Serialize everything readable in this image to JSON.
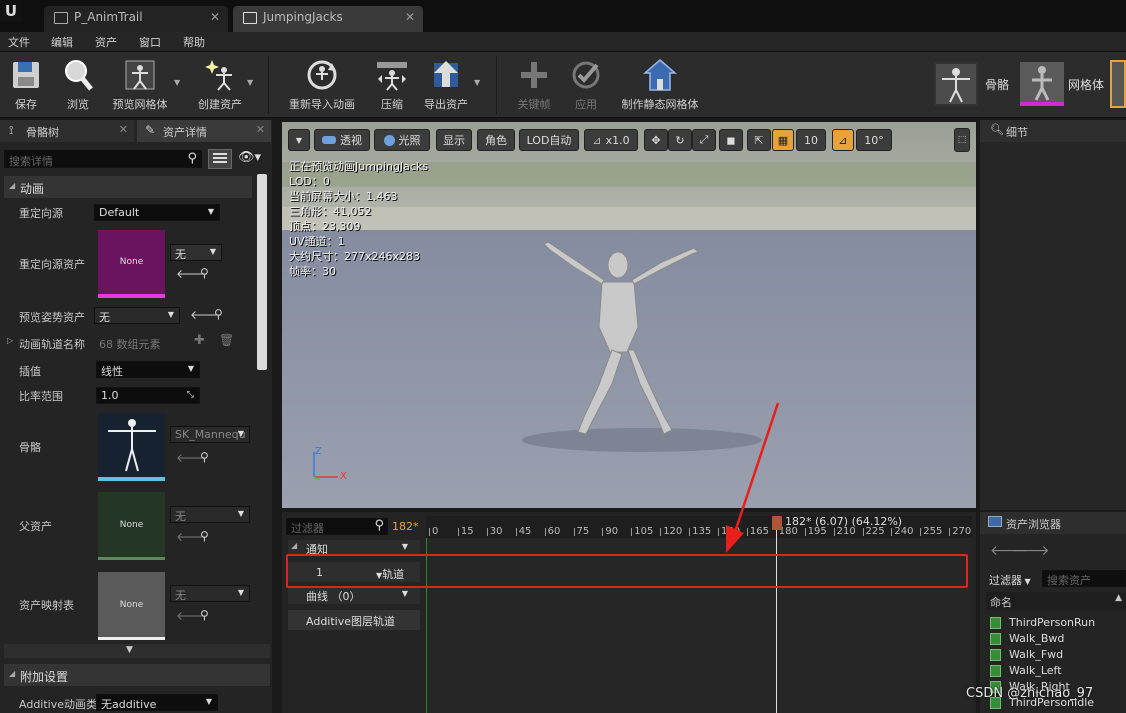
{
  "title_bar": {
    "logo": "U",
    "tabs": [
      {
        "label": "P_AnimTrail",
        "icon": "level-icon",
        "active": false
      },
      {
        "label": "JumpingJacks",
        "icon": "animation-sequence-icon",
        "active": true
      }
    ]
  },
  "menu": [
    "文件",
    "编辑",
    "资产",
    "窗口",
    "帮助"
  ],
  "toolbar": {
    "save": "保存",
    "browse": "浏览",
    "preview_mesh": "预览网格体",
    "create_asset": "创建资产",
    "reimport": "重新导入动画",
    "compress": "压缩",
    "export": "导出资产",
    "keyframe": "关键帧",
    "apply": "应用",
    "make_static_mesh": "制作静态网格体",
    "skeleton": "骨骼",
    "mesh": "网格体"
  },
  "left_panel": {
    "tabs": [
      "骨骼树",
      "资产详情"
    ],
    "search_placeholder": "搜索详情",
    "animation_category": "动画",
    "retarget_source_label": "重定向源",
    "retarget_source_value": "Default",
    "retarget_source_asset_label": "重定向源资产",
    "retarget_source_asset_thumb": "None",
    "retarget_source_asset_value": "无",
    "preview_pose_label": "预览姿势资产",
    "preview_pose_value": "无",
    "anim_track_names_label": "动画轨道名称",
    "anim_track_names_value": "68 数组元素",
    "interpolation_label": "插值",
    "interpolation_value": "线性",
    "rate_scale_label": "比率范围",
    "rate_scale_value": "1.0",
    "skeleton_label": "骨骼",
    "skeleton_value": "SK_Mannequ",
    "parent_asset_label": "父资产",
    "parent_asset_thumb": "None",
    "parent_asset_value": "无",
    "asset_mapping_label": "资产映射表",
    "asset_mapping_thumb": "None",
    "asset_mapping_value": "无",
    "additional_settings": "附加设置",
    "additive_type_label": "Additive动画类",
    "additive_type_value": "无additive"
  },
  "viewport": {
    "toolbar": {
      "perspective": "透视",
      "lit": "光照",
      "show": "显示",
      "character": "角色",
      "lod": "LOD自动",
      "speed": "x1.0",
      "grid_snap": "10",
      "rot_snap": "10°"
    },
    "info": [
      "正在预览动画JumpingJacks",
      "LOD：0",
      "当前屏幕大小：1.463",
      "三角形：41,052",
      "顶点：23,309",
      "UV通道：1",
      "大约尺寸：277x246x283",
      "帧率：30"
    ],
    "axis": {
      "z": "Z",
      "x": "X"
    }
  },
  "timeline": {
    "filter_placeholder": "过滤器",
    "frame_count": "182*",
    "playhead": "182* (6.07) (64.12%)",
    "ticks": [
      "0",
      "15",
      "30",
      "45",
      "60",
      "75",
      "90",
      "105",
      "120",
      "135",
      "150",
      "165",
      "180",
      "195",
      "210",
      "225",
      "240",
      "255",
      "270"
    ],
    "notify_label": "通知",
    "track_number": "1",
    "track_label": "轨道",
    "curves_label": "曲线 （0）",
    "additive_track_label": "Additive图层轨道"
  },
  "details_panel": {
    "title": "细节"
  },
  "asset_browser": {
    "title": "资产浏览器",
    "filter": "过滤器",
    "search_placeholder": "搜索资产",
    "column": "命名",
    "items": [
      "ThirdPersonRun",
      "Walk_Bwd",
      "Walk_Fwd",
      "Walk_Left",
      "Walk_Right",
      "ThirdPersonIdle"
    ]
  },
  "watermark": "CSDN @zhichao_97",
  "colors": {
    "highlight_box": "#e8201c",
    "arrow": "#e8201c",
    "accent_orange": "#e8a23a",
    "playhead": "#b0553a",
    "thumb_magenta": "#7a1466"
  }
}
